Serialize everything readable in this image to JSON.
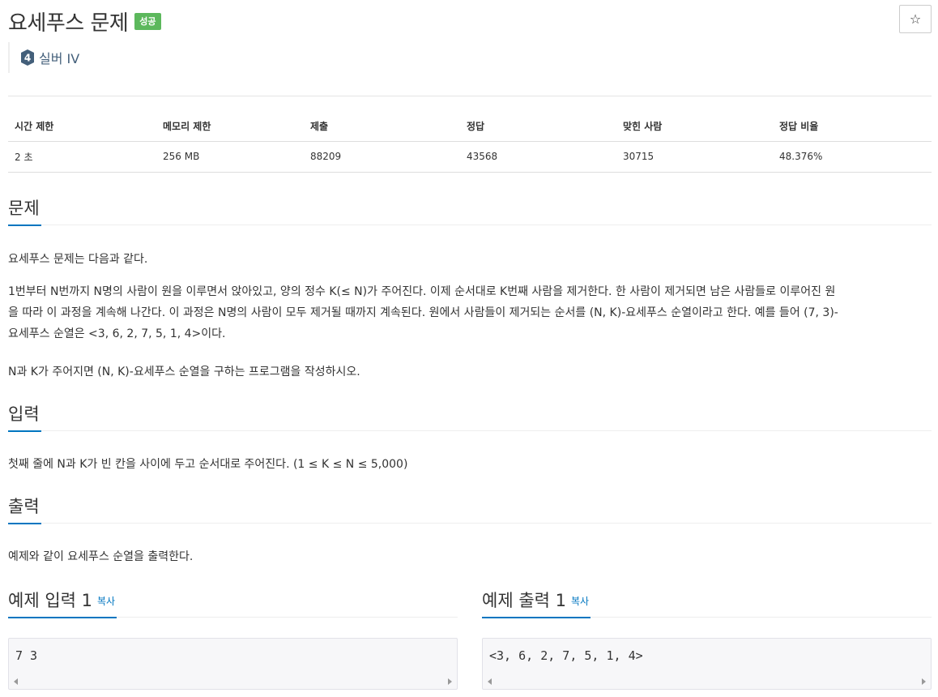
{
  "header": {
    "title": "요세푸스 문제",
    "badge": "성공",
    "star_icon": "☆",
    "tier": "실버 IV",
    "tier_number": "4"
  },
  "info_table": {
    "columns": [
      "시간 제한",
      "메모리 제한",
      "제출",
      "정답",
      "맞힌 사람",
      "정답 비율"
    ],
    "values": [
      "2 초",
      "256 MB",
      "88209",
      "43568",
      "30715",
      "48.376%"
    ]
  },
  "problem": {
    "heading": "문제",
    "p1": "요세푸스 문제는 다음과 같다.",
    "p2_line1": "1번부터 N번까지 N명의 사람이 원을 이루면서 앉아있고, 양의 정수 K(≤ N)가 주어진다. 이제 순서대로 K번째 사람을 제거한다. 한 사람이 제거되면 남은 사람들로 이루어진 원",
    "p2_line2": "을 따라 이 과정을 계속해 나간다. 이 과정은 N명의 사람이 모두 제거될 때까지 계속된다. 원에서 사람들이 제거되는 순서를 (N, K)-요세푸스 순열이라고 한다. 예를 들어 (7, 3)-",
    "p2_line3": "요세푸스 순열은 <3, 6, 2, 7, 5, 1, 4>이다.",
    "p3": "N과 K가 주어지면 (N, K)-요세푸스 순열을 구하는 프로그램을 작성하시오."
  },
  "input": {
    "heading": "입력",
    "text": "첫째 줄에 N과 K가 빈 칸을 사이에 두고 순서대로 주어진다. (1 ≤ K ≤ N ≤ 5,000)"
  },
  "output": {
    "heading": "출력",
    "text": "예제와 같이 요세푸스 순열을 출력한다."
  },
  "sample_input": {
    "heading": "예제 입력 1",
    "copy": "복사",
    "content": "7 3"
  },
  "sample_output": {
    "heading": "예제 출력 1",
    "copy": "복사",
    "content": "<3, 6, 2, 7, 5, 1, 4>"
  },
  "colors": {
    "accent": "#0076c0",
    "success": "#5cb85c",
    "tier_silver": "#435f7a"
  }
}
